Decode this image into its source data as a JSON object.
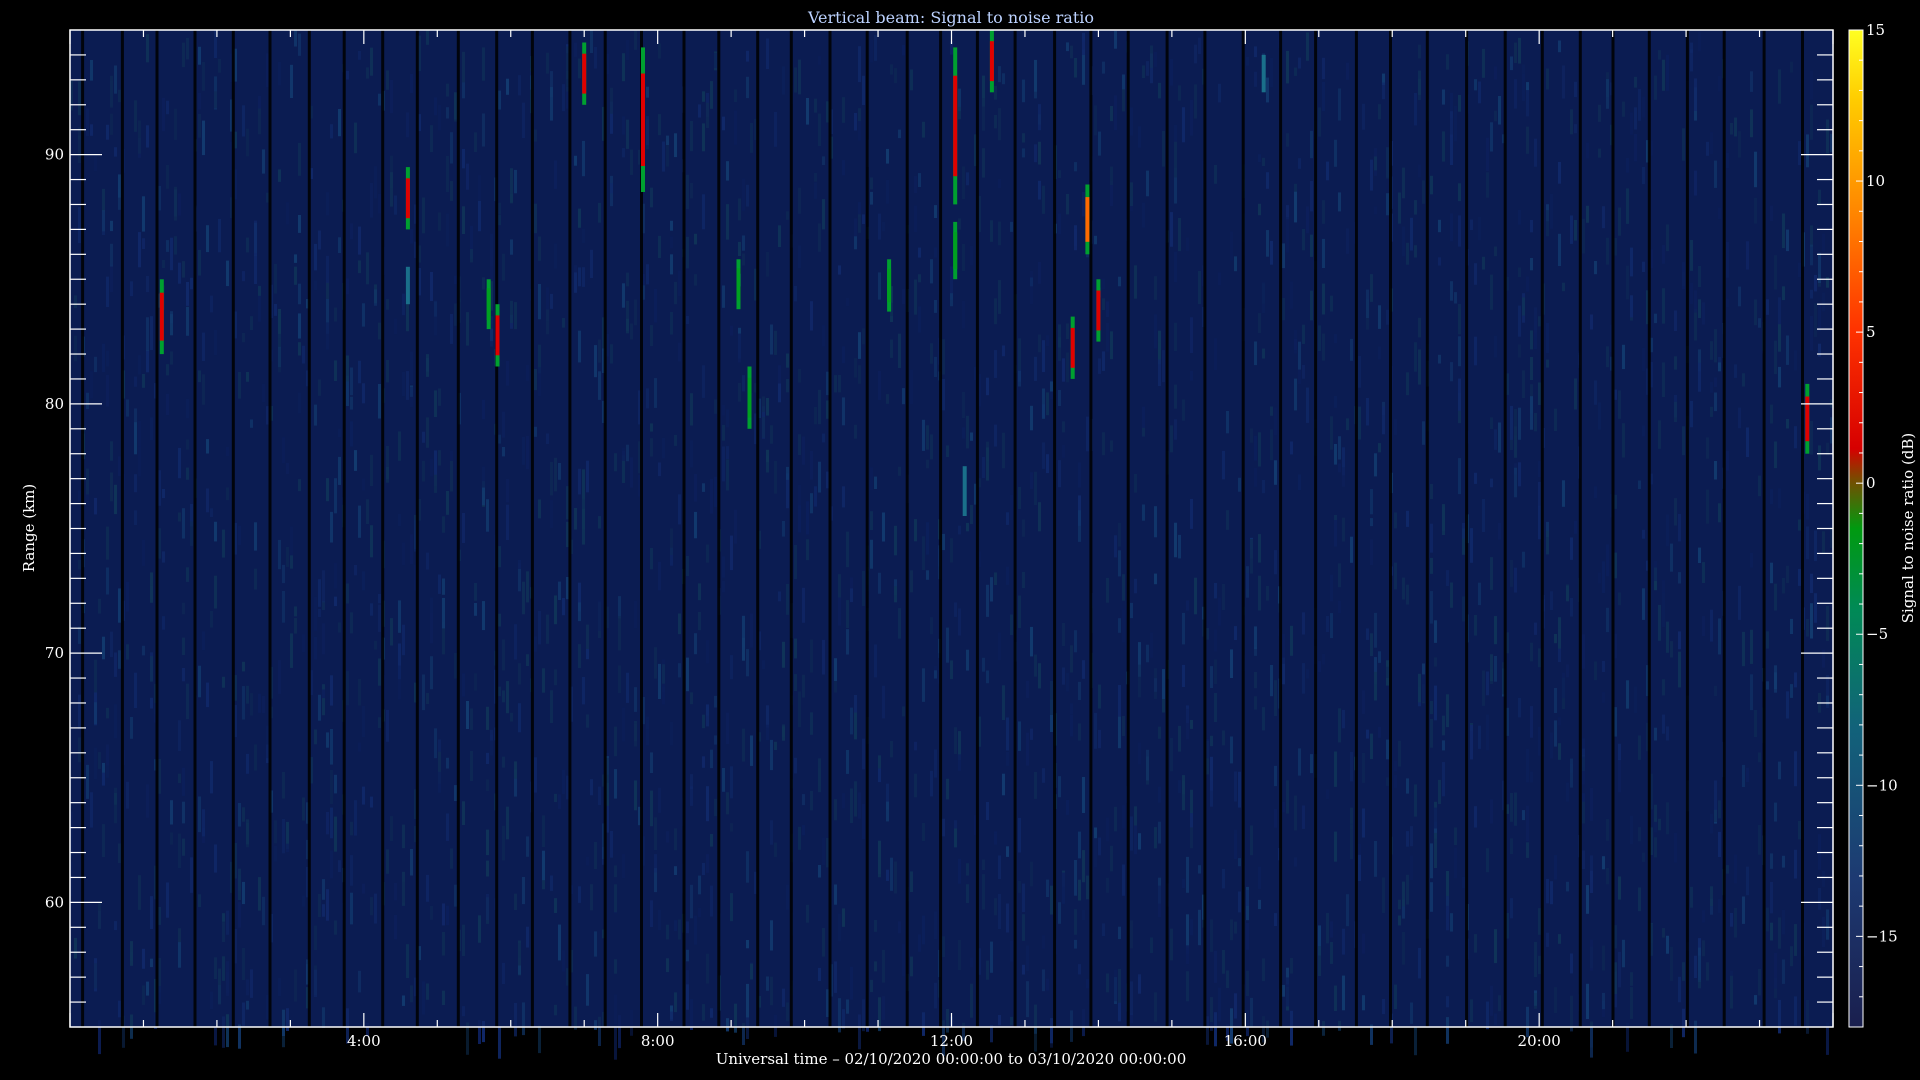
{
  "chart_data": {
    "type": "heatmap",
    "title": "Vertical beam: Signal to noise ratio",
    "xlabel": "Universal time – 02/10/2020 00:00:00 to 03/10/2020 00:00:00",
    "ylabel": "Range (km)",
    "colorbar_label": "Signal to noise ratio (dB)",
    "xlim_hours": [
      0,
      24
    ],
    "ylim_km": [
      55,
      95
    ],
    "clim_db": [
      -18,
      15
    ],
    "x_ticks": [
      {
        "hours": 4,
        "label": "4:00"
      },
      {
        "hours": 8,
        "label": "8:00"
      },
      {
        "hours": 12,
        "label": "12:00"
      },
      {
        "hours": 16,
        "label": "16:00"
      },
      {
        "hours": 20,
        "label": "20:00"
      }
    ],
    "y_ticks": [
      {
        "km": 60,
        "label": "60"
      },
      {
        "km": 70,
        "label": "70"
      },
      {
        "km": 80,
        "label": "80"
      },
      {
        "km": 90,
        "label": "90"
      }
    ],
    "colorbar_ticks": [
      {
        "db": 15,
        "label": "15"
      },
      {
        "db": 10,
        "label": "10"
      },
      {
        "db": 5,
        "label": "5"
      },
      {
        "db": 0,
        "label": "0"
      },
      {
        "db": -5,
        "label": "−5"
      },
      {
        "db": -10,
        "label": "−10"
      },
      {
        "db": -15,
        "label": "−15"
      }
    ],
    "background_db": -16,
    "echoes": [
      {
        "hours": 1.25,
        "range_km": [
          82,
          85
        ],
        "peak_db": 3
      },
      {
        "hours": 4.6,
        "range_km": [
          87,
          89.5
        ],
        "peak_db": 2
      },
      {
        "hours": 4.6,
        "range_km": [
          84,
          85.5
        ],
        "peak_db": -6
      },
      {
        "hours": 5.7,
        "range_km": [
          83,
          85
        ],
        "peak_db": -4
      },
      {
        "hours": 5.82,
        "range_km": [
          81.5,
          84
        ],
        "peak_db": 4
      },
      {
        "hours": 7.0,
        "range_km": [
          92,
          94.5
        ],
        "peak_db": 2
      },
      {
        "hours": 7.8,
        "range_km": [
          88.5,
          94.3
        ],
        "peak_db": 3
      },
      {
        "hours": 9.1,
        "range_km": [
          83.8,
          85.8
        ],
        "peak_db": -5
      },
      {
        "hours": 9.25,
        "range_km": [
          79,
          81.5
        ],
        "peak_db": -4
      },
      {
        "hours": 11.15,
        "range_km": [
          83.7,
          85.8
        ],
        "peak_db": -5
      },
      {
        "hours": 12.05,
        "range_km": [
          88,
          94.3
        ],
        "peak_db": 2
      },
      {
        "hours": 12.05,
        "range_km": [
          85,
          87.3
        ],
        "peak_db": -5
      },
      {
        "hours": 12.55,
        "range_km": [
          92.5,
          95
        ],
        "peak_db": 2
      },
      {
        "hours": 13.65,
        "range_km": [
          81,
          83.5
        ],
        "peak_db": 4
      },
      {
        "hours": 13.85,
        "range_km": [
          86,
          88.8
        ],
        "peak_db": 6
      },
      {
        "hours": 14.0,
        "range_km": [
          82.5,
          85
        ],
        "peak_db": 1
      },
      {
        "hours": 23.65,
        "range_km": [
          78,
          80.8
        ],
        "peak_db": 2
      },
      {
        "hours": 12.18,
        "range_km": [
          75.5,
          77.5
        ],
        "peak_db": -10
      },
      {
        "hours": 16.25,
        "range_km": [
          92.5,
          94
        ],
        "peak_db": -8
      }
    ]
  }
}
